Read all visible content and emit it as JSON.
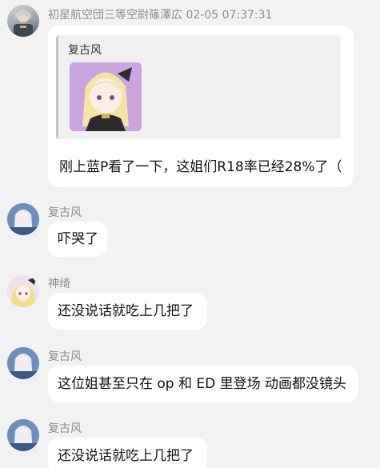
{
  "messages": [
    {
      "sender": "初星航空団三等空尉篠澤広  02-05 07:37:31",
      "reply_to": "复古风",
      "text": "刚上蓝P看了一下，这姐们R18率已经28%了（"
    },
    {
      "sender": "复古风",
      "text": "吓哭了"
    },
    {
      "sender": "神绮",
      "text": "还没说话就吃上几把了"
    },
    {
      "sender": "复古风",
      "text": "这位姐甚至只在 op 和 ED 里登场 动画都没镜头"
    },
    {
      "sender": "复古风",
      "text": "还没说话就吃上几把了"
    }
  ]
}
